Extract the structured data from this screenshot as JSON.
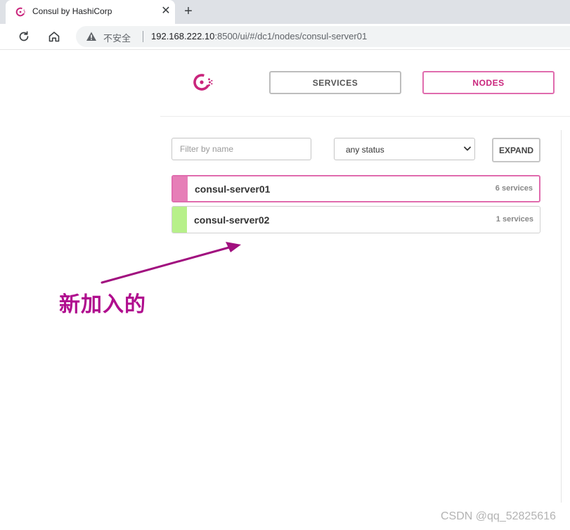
{
  "browser": {
    "tab_title": "Consul by HashiCorp",
    "tab_close_glyph": "✕",
    "new_tab_glyph": "+",
    "security_label": "不安全",
    "url_host": "192.168.222.10",
    "url_rest": ":8500/ui/#/dc1/nodes/consul-server01",
    "icons": [
      "consul-favicon-icon",
      "close-icon",
      "plus-icon",
      "reload-icon",
      "home-icon",
      "warning-triangle-icon"
    ]
  },
  "app": {
    "brand_color": "#c9257c",
    "nav": {
      "services": "SERVICES",
      "nodes": "NODES",
      "active": "NODES"
    },
    "filter": {
      "placeholder": "Filter by name",
      "value": ""
    },
    "status_select": {
      "selected": "any status"
    },
    "expand_label": "EXPAND",
    "nodes": [
      {
        "name": "consul-server01",
        "services": "6 services",
        "status_color": "#e67eb7",
        "selected": true
      },
      {
        "name": "consul-server02",
        "services": "1 services",
        "status_color": "#b7f08a",
        "selected": false
      }
    ]
  },
  "annotation": {
    "text": "新加入的",
    "color": "#b00d8e"
  },
  "watermark": "CSDN @qq_52825616"
}
